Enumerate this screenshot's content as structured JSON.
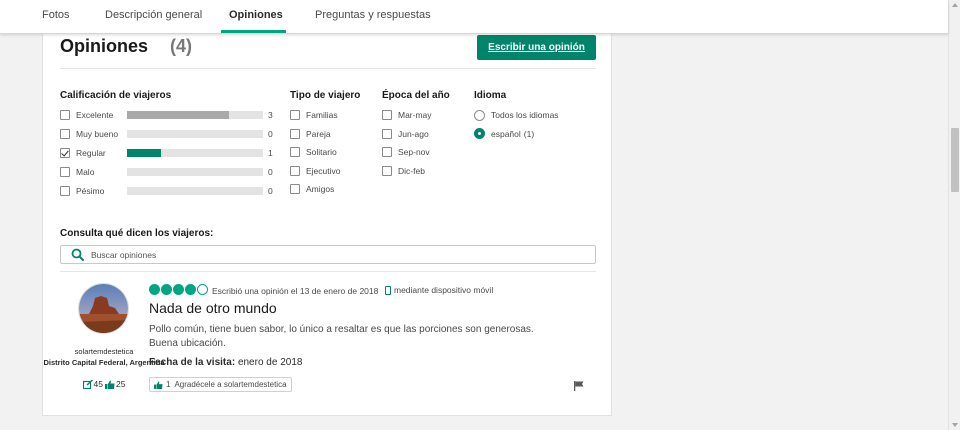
{
  "tabs": [
    {
      "label": "Fotos"
    },
    {
      "label": "Descripción general"
    },
    {
      "label": "Opiniones",
      "active": true
    },
    {
      "label": "Preguntas y respuestas"
    }
  ],
  "reviews_header": {
    "title": "Opiniones",
    "count": "(4)",
    "write_button": "Escribir una opinión"
  },
  "filters": {
    "rating": {
      "heading": "Calificación de viajeros",
      "options": [
        {
          "label": "Excelente",
          "count": "3",
          "fraction": 0.75,
          "checked": false
        },
        {
          "label": "Muy bueno",
          "count": "0",
          "fraction": 0,
          "checked": false
        },
        {
          "label": "Regular",
          "count": "1",
          "fraction": 0.25,
          "checked": true
        },
        {
          "label": "Malo",
          "count": "0",
          "fraction": 0,
          "checked": false
        },
        {
          "label": "Pésimo",
          "count": "0",
          "fraction": 0,
          "checked": false
        }
      ]
    },
    "traveler_type": {
      "heading": "Tipo de viajero",
      "options": [
        "Familias",
        "Pareja",
        "Solitario",
        "Ejecutivo",
        "Amigos"
      ]
    },
    "season": {
      "heading": "Época del año",
      "options": [
        "Mar-may",
        "Jun-ago",
        "Sep-nov",
        "Dic-feb"
      ]
    },
    "language": {
      "heading": "Idioma",
      "options": [
        {
          "label": "Todos los idiomas",
          "selected": false
        },
        {
          "label": "español",
          "count": "(1)",
          "selected": true
        }
      ]
    }
  },
  "search": {
    "label": "Consulta qué dicen los viajeros:",
    "placeholder": "Buscar opiniones"
  },
  "review": {
    "user": {
      "name": "solartemdestetica",
      "location": "Distrito Capital Federal, Argentina",
      "contributions": "45",
      "helpful_votes": "25"
    },
    "rating_bubbles": 4,
    "written": "Escribió una opinión el 13 de enero de 2018",
    "device": "mediante dispositivo móvil",
    "title": "Nada de otro mundo",
    "body_line1": "Pollo común, tiene buen sabor, lo único a resaltar es que las porciones son generosas.",
    "body_line2": "Buena ubicación.",
    "visit_label": "Fecha de la visita:",
    "visit_date": "enero de 2018",
    "thanks_count": "1",
    "thanks_label": "Agradécele a solartemdestetica"
  },
  "colors": {
    "accent": "#00a680",
    "button": "#00856b",
    "bar_default": "#a9a9a9",
    "bar_selected": "#00856b"
  }
}
